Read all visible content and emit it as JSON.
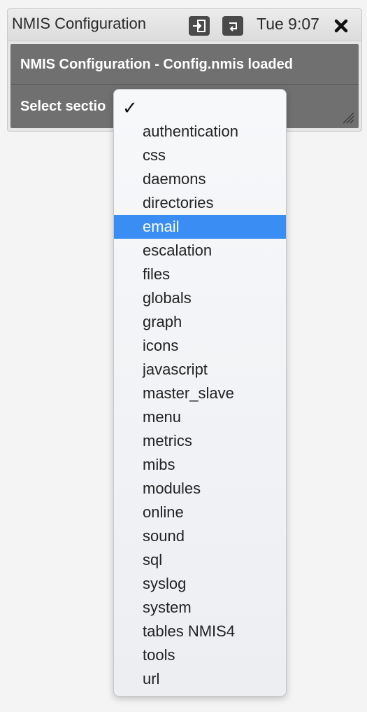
{
  "window": {
    "title": "NMIS Configuration",
    "clock": "Tue 9:07"
  },
  "panel": {
    "header_text": "NMIS Configuration - Config.nmis loaded",
    "select_label": "Select sectio"
  },
  "dropdown": {
    "check_glyph": "✓",
    "selected": "email",
    "options": [
      "authentication",
      "css",
      "daemons",
      "directories",
      "email",
      "escalation",
      "files",
      "globals",
      "graph",
      "icons",
      "javascript",
      "master_slave",
      "menu",
      "metrics",
      "mibs",
      "modules",
      "online",
      "sound",
      "sql",
      "syslog",
      "system",
      "tables NMIS4",
      "tools",
      "url"
    ]
  },
  "colors": {
    "highlight": "#3a8df2",
    "panel": "#707070",
    "titlebar": "#e0e0e0"
  }
}
